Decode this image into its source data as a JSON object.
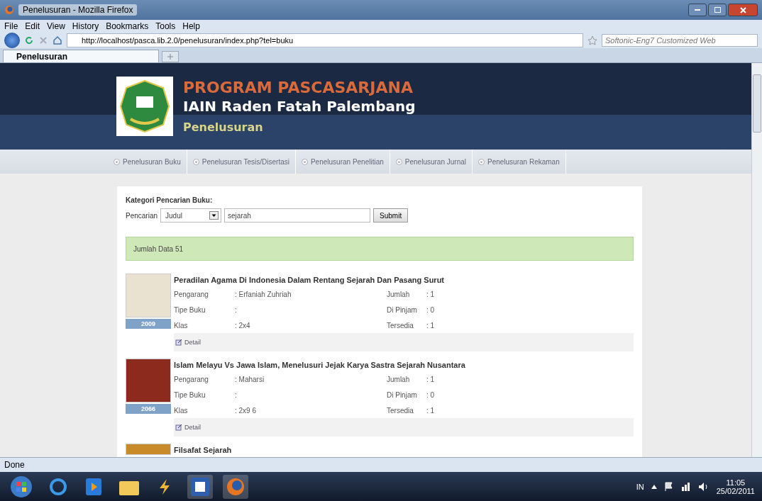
{
  "window": {
    "title": "Penelusuran - Mozilla Firefox"
  },
  "menu": [
    "File",
    "Edit",
    "View",
    "History",
    "Bookmarks",
    "Tools",
    "Help"
  ],
  "address": {
    "url": "http://localhost/pasca.lib.2.0/penelusuran/index.php?tel=buku"
  },
  "web_search": {
    "placeholder": "Softonic-Eng7 Customized Web"
  },
  "tabs": [
    {
      "label": "Penelusuran",
      "selected": true
    }
  ],
  "site_header": {
    "title": "PROGRAM PASCASARJANA",
    "subtitle": "IAIN Raden Fatah Palembang",
    "section": "Penelusuran"
  },
  "nav": [
    "Penelusuran Buku",
    "Penelusuran Tesis/Disertasi",
    "Penelusuran Penelitian",
    "Penelusuran Jurnal",
    "Penelusuran Rekaman"
  ],
  "search_form": {
    "heading": "Kategori Pencarian Buku:",
    "label": "Pencarian",
    "category": "Judul",
    "query": "sejarah",
    "button": "Submit"
  },
  "result_count": "Jumlah Data 51",
  "books": [
    {
      "title": "Peradilan Agama Di Indonesia Dalam Rentang Sejarah Dan Pasang Surut",
      "year": "2009",
      "detail": "Detail",
      "fields_left": [
        {
          "label": "Pengarang",
          "value": ": Erfaniah Zuhriah"
        },
        {
          "label": "Tipe Buku",
          "value": ":"
        },
        {
          "label": "Klas",
          "value": ": 2x4"
        }
      ],
      "fields_right": [
        {
          "label": "Jumlah",
          "value": ": 1"
        },
        {
          "label": "Di Pinjam",
          "value": ": 0"
        },
        {
          "label": "Tersedia",
          "value": ": 1"
        }
      ]
    },
    {
      "title": "Islam Melayu Vs Jawa Islam, Menelusuri Jejak Karya Sastra Sejarah Nusantara",
      "year": "2066",
      "detail": "Detail",
      "fields_left": [
        {
          "label": "Pengarang",
          "value": ": Maharsi"
        },
        {
          "label": "Tipe Buku",
          "value": ":"
        },
        {
          "label": "Klas",
          "value": ": 2x9 6"
        }
      ],
      "fields_right": [
        {
          "label": "Jumlah",
          "value": ": 1"
        },
        {
          "label": "Di Pinjam",
          "value": ": 0"
        },
        {
          "label": "Tersedia",
          "value": ": 1"
        }
      ]
    },
    {
      "title": "Filsafat Sejarah"
    }
  ],
  "status_bar": "Done",
  "taskbar": {
    "language": "IN",
    "time": "11:05",
    "date": "25/02/2011"
  }
}
